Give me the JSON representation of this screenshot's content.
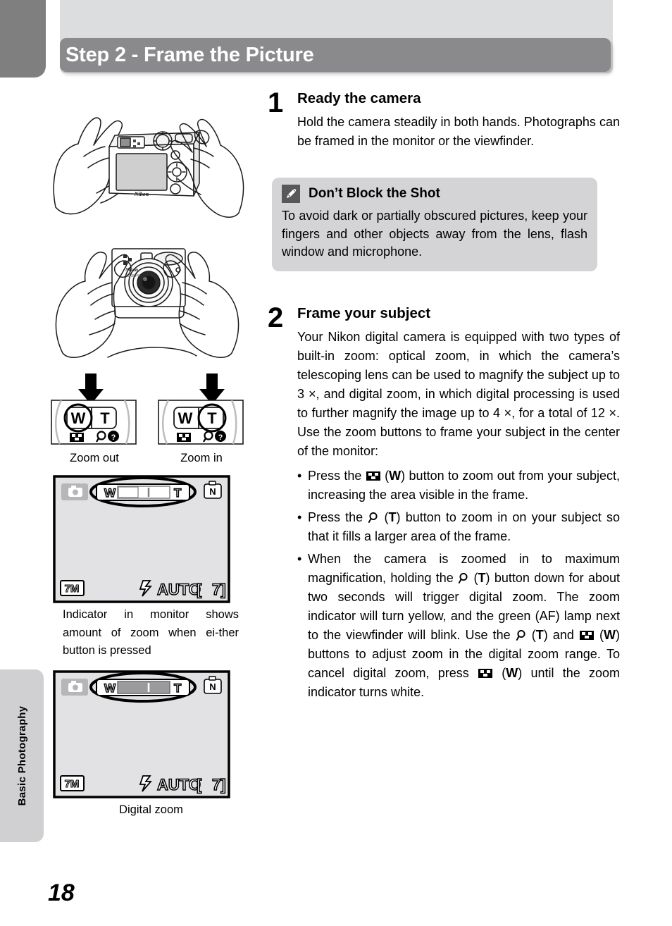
{
  "header": {
    "title": "Step 2 - Frame the Picture"
  },
  "side_tab": {
    "label": "Basic Photography"
  },
  "page_number": "18",
  "left_column": {
    "illustration_1_name": "hands-holding-camera-rear-view",
    "illustration_2_name": "hands-holding-camera-front-view",
    "zoom_buttons": [
      {
        "letter_w": "W",
        "letter_t": "T",
        "caption": "Zoom out",
        "pressed": "W"
      },
      {
        "letter_w": "W",
        "letter_t": "T",
        "caption": "Zoom in",
        "pressed": "T"
      }
    ],
    "monitor_1": {
      "zoom_w": "W",
      "zoom_t": "T",
      "image_size": "7M",
      "flash_mode": "AUTO",
      "frames_remaining": "7",
      "bracket_left": "[",
      "bracket_right": "]",
      "battery_label": "N",
      "fill_state": "empty"
    },
    "caption_1": "Indicator in monitor shows amount of zoom when ei-ther button is pressed",
    "monitor_2": {
      "zoom_w": "W",
      "zoom_t": "T",
      "image_size": "7M",
      "flash_mode": "AUTO",
      "frames_remaining": "7",
      "bracket_left": "[",
      "bracket_right": "]",
      "battery_label": "N",
      "fill_state": "filled"
    },
    "caption_2": "Digital zoom"
  },
  "steps": [
    {
      "number": "1",
      "title": "Ready the camera",
      "text": "Hold the camera steadily in both hands. Photographs can be framed in the monitor or the viewfinder."
    },
    {
      "number": "2",
      "title": "Frame your subject",
      "text": "Your Nikon digital camera is equipped with two types of built-in zoom: optical zoom, in which the camera’s telescoping lens can be used to magnify the subject up to 3 ×, and digital zoom, in which digital processing is used to further magnify the image up to 4 ×, for a total of 12 ×. Use the zoom buttons to frame your subject in the center of the monitor:"
    }
  ],
  "tip_box": {
    "icon": "pencil-icon",
    "title": "Don’t Block the Shot",
    "text": "To avoid dark or partially obscured pictures, keep your fingers and other objects away from the lens, flash window and microphone."
  },
  "bullets": [
    {
      "parts": [
        {
          "t": "text",
          "v": "Press the "
        },
        {
          "t": "icon",
          "v": "wide-angle-icon"
        },
        {
          "t": "text",
          "v": " ("
        },
        {
          "t": "bold",
          "v": "W"
        },
        {
          "t": "text",
          "v": ") button to zoom out from your subject, increasing the area visible in the frame."
        }
      ]
    },
    {
      "parts": [
        {
          "t": "text",
          "v": "Press the "
        },
        {
          "t": "icon",
          "v": "magnifier-icon"
        },
        {
          "t": "text",
          "v": " ("
        },
        {
          "t": "bold",
          "v": "T"
        },
        {
          "t": "text",
          "v": ") button to zoom in on your subject so that it fills a larger area of the frame."
        }
      ]
    },
    {
      "parts": [
        {
          "t": "text",
          "v": "When the camera is zoomed in to maximum magnification, holding the "
        },
        {
          "t": "icon",
          "v": "magnifier-icon"
        },
        {
          "t": "text",
          "v": " ("
        },
        {
          "t": "bold",
          "v": "T"
        },
        {
          "t": "text",
          "v": ") button down for about two seconds will trigger digital zoom. The zoom indicator will turn yellow, and the green (AF) lamp next to the viewfinder will blink. Use the "
        },
        {
          "t": "icon",
          "v": "magnifier-icon"
        },
        {
          "t": "text",
          "v": " ("
        },
        {
          "t": "bold",
          "v": "T"
        },
        {
          "t": "text",
          "v": ") and "
        },
        {
          "t": "icon",
          "v": "wide-angle-icon"
        },
        {
          "t": "text",
          "v": " ("
        },
        {
          "t": "bold",
          "v": "W"
        },
        {
          "t": "text",
          "v": ") buttons to adjust zoom in the digital zoom range. To cancel digital zoom, press "
        },
        {
          "t": "icon",
          "v": "wide-angle-icon"
        },
        {
          "t": "text",
          "v": " ("
        },
        {
          "t": "bold",
          "v": "W"
        },
        {
          "t": "text",
          "v": ") until the zoom indicator turns white."
        }
      ]
    }
  ],
  "colors": {
    "header_bar": "#8a8a8c",
    "header_backplate": "#dcdddf",
    "corner_tab": "#7f7f7f",
    "side_tab": "#d0d0d2",
    "tip_box_bg": "#d4d4d6",
    "tip_icon_bg": "#58585a",
    "monitor_bg": "#e2e2e4"
  }
}
